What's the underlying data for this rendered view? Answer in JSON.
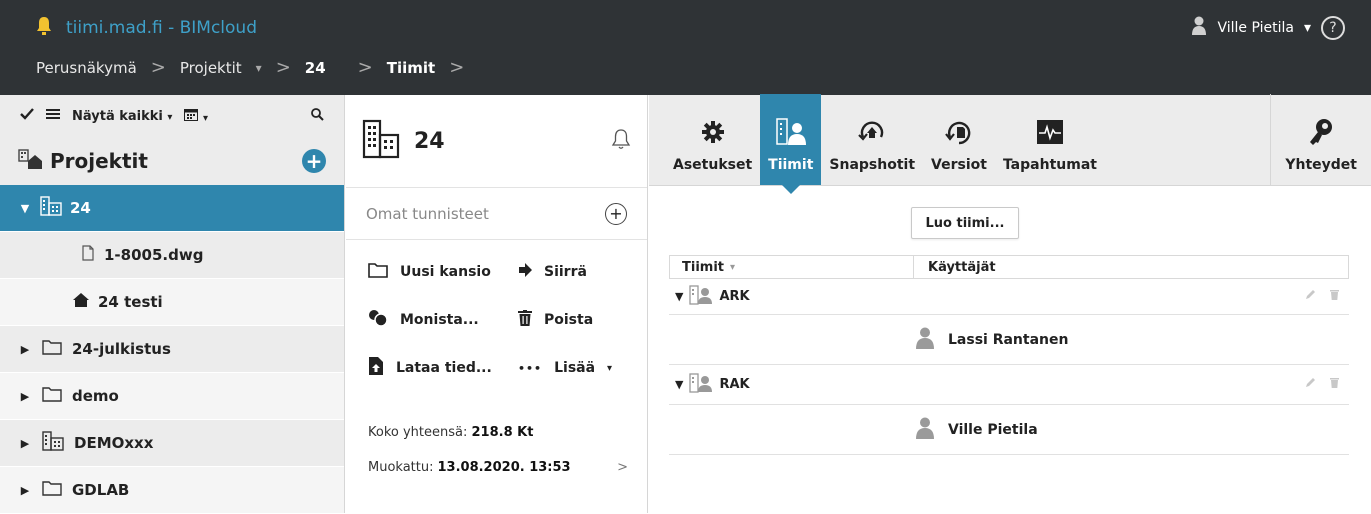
{
  "header": {
    "app_title": "tiimi.mad.fi - BIMcloud",
    "user_name": "Ville Pietila",
    "user_caret": "▾",
    "help_label": "?",
    "breadcrumb": {
      "home": "Perusnäkymä",
      "projects": "Projektit",
      "projects_caret": "▾",
      "project": "24",
      "current": "Tiimit",
      "separator": ">"
    }
  },
  "sidebar": {
    "show_all_label": "Näytä kaikki",
    "caret": "▾",
    "title": "Projektit",
    "add_label": "+",
    "items": [
      {
        "label": "24",
        "icon": "building-icon",
        "expander": "▼",
        "active": true
      },
      {
        "label": "1-8005.dwg",
        "icon": "file-icon"
      },
      {
        "label": "24 testi",
        "icon": "house-icon"
      },
      {
        "label": "24-julkistus",
        "icon": "folder-icon",
        "expander": "▶"
      },
      {
        "label": "demo",
        "icon": "folder-icon",
        "expander": "▶"
      },
      {
        "label": "DEMOxxx",
        "icon": "building-icon",
        "expander": "▶"
      },
      {
        "label": "GDLAB",
        "icon": "folder-icon",
        "expander": "▶"
      }
    ]
  },
  "middle": {
    "project_number": "24",
    "tags_placeholder": "Omat tunnisteet",
    "tags_add": "+",
    "actions": {
      "new_folder": "Uusi kansio",
      "move": "Siirrä",
      "duplicate": "Monista...",
      "delete": "Poista",
      "upload": "Lataa tied...",
      "more": "Lisää",
      "more_caret": "▾",
      "more_dots": "•••"
    },
    "size_label": "Koko yhteensä:",
    "size_value": "218.8 Kt",
    "modified_label": "Muokattu:",
    "modified_value": "13.08.2020. 13:53",
    "info_arrow": ">"
  },
  "right": {
    "tabs": {
      "settings": "Asetukset",
      "teams": "Tiimit",
      "snapshots": "Snapshotit",
      "versions": "Versiot",
      "events": "Tapahtumat",
      "connections": "Yhteydet"
    },
    "create_team_button": "Luo tiimi...",
    "columns": {
      "teams": "Tiimit",
      "teams_sort": "▾",
      "users": "Käyttäjät"
    },
    "teams": [
      {
        "name": "ARK",
        "expander": "▼",
        "members": [
          {
            "name": "Lassi Rantanen"
          }
        ]
      },
      {
        "name": "RAK",
        "expander": "▼",
        "members": [
          {
            "name": "Ville Pietila"
          }
        ]
      }
    ]
  },
  "colors": {
    "header_bg": "#2f3336",
    "accent": "#2f86ad",
    "brand_text": "#3ea0c8",
    "bell_icon": "#f2c230",
    "panel_bg": "#ececec"
  }
}
